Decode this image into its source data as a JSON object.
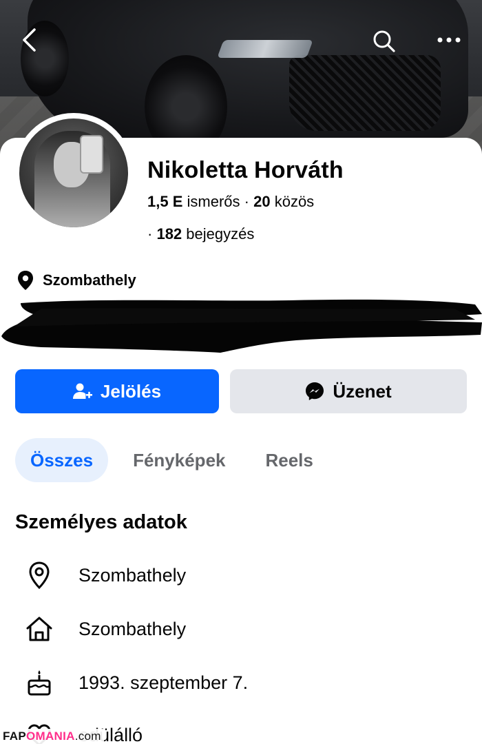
{
  "profile": {
    "name": "Nikoletta Horváth",
    "friends_count": "1,5 E",
    "friends_label": "ismerős",
    "separator": "·",
    "mutual_count": "20",
    "mutual_label": "közös",
    "posts_count": "182",
    "posts_label": "bejegyzés",
    "location": "Szombathely"
  },
  "actions": {
    "add_friend_label": "Jelölés",
    "message_label": "Üzenet"
  },
  "tabs": [
    {
      "label": "Összes",
      "active": true
    },
    {
      "label": "Fényképek",
      "active": false
    },
    {
      "label": "Reels",
      "active": false
    }
  ],
  "details": {
    "title": "Személyes adatok",
    "items": [
      {
        "icon": "location-pin-icon",
        "text": "Szombathely"
      },
      {
        "icon": "home-icon",
        "text": "Szombathely"
      },
      {
        "icon": "birthday-cake-icon",
        "text": "1993. szeptember 7."
      },
      {
        "icon": "heart-icon",
        "text": "edülálló"
      }
    ]
  },
  "watermark": {
    "part1": "FAP",
    "part2": "OMANIA",
    "part3": ".com"
  },
  "colors": {
    "primary": "#0866ff",
    "secondary_button": "#e4e6eb",
    "active_tab_bg": "#e7f0fd",
    "muted_text": "#65676b"
  }
}
